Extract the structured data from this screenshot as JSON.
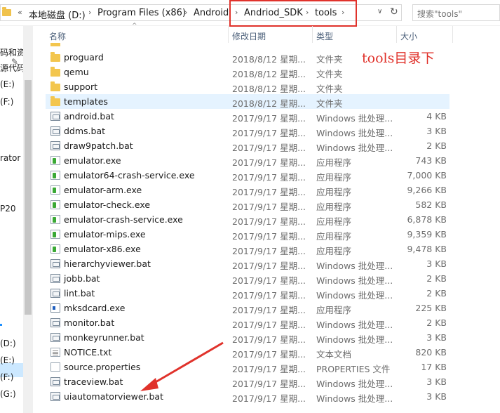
{
  "address": {
    "prefix": "«",
    "crumbs": [
      "本地磁盘 (D:)",
      "Program Files (x86)",
      "Android",
      "Andriod_SDK",
      "tools"
    ],
    "search_placeholder": "搜索\"tools\""
  },
  "nav": {
    "items": [
      "码和资",
      "源代码",
      "(E:)",
      "(F:)",
      "rator",
      "P20",
      "(D:)",
      "(E:)",
      "(F:)",
      "(G:)"
    ]
  },
  "columns": {
    "name": "名称",
    "date": "修改日期",
    "type": "类型",
    "size": "大小"
  },
  "annotation": "tools目录下",
  "accent": "#e0322b",
  "files": [
    {
      "name": "proguard",
      "date": "2018/8/12 星期...",
      "type": "文件夹",
      "size": "",
      "icon": "folder-icon"
    },
    {
      "name": "qemu",
      "date": "2018/8/12 星期...",
      "type": "文件夹",
      "size": "",
      "icon": "folder-icon"
    },
    {
      "name": "support",
      "date": "2018/8/12 星期...",
      "type": "文件夹",
      "size": "",
      "icon": "folder-icon"
    },
    {
      "name": "templates",
      "date": "2018/8/12 星期...",
      "type": "文件夹",
      "size": "",
      "icon": "folder-icon",
      "selected": true
    },
    {
      "name": "android.bat",
      "date": "2017/9/17 星期...",
      "type": "Windows 批处理...",
      "size": "4 KB",
      "icon": "batch-file-icon"
    },
    {
      "name": "ddms.bat",
      "date": "2017/9/17 星期...",
      "type": "Windows 批处理...",
      "size": "3 KB",
      "icon": "batch-file-icon"
    },
    {
      "name": "draw9patch.bat",
      "date": "2017/9/17 星期...",
      "type": "Windows 批处理...",
      "size": "2 KB",
      "icon": "batch-file-icon"
    },
    {
      "name": "emulator.exe",
      "date": "2017/9/17 星期...",
      "type": "应用程序",
      "size": "743 KB",
      "icon": "exe-icon"
    },
    {
      "name": "emulator64-crash-service.exe",
      "date": "2017/9/17 星期...",
      "type": "应用程序",
      "size": "7,000 KB",
      "icon": "exe-icon"
    },
    {
      "name": "emulator-arm.exe",
      "date": "2017/9/17 星期...",
      "type": "应用程序",
      "size": "9,266 KB",
      "icon": "exe-icon"
    },
    {
      "name": "emulator-check.exe",
      "date": "2017/9/17 星期...",
      "type": "应用程序",
      "size": "582 KB",
      "icon": "exe-icon"
    },
    {
      "name": "emulator-crash-service.exe",
      "date": "2017/9/17 星期...",
      "type": "应用程序",
      "size": "6,878 KB",
      "icon": "exe-icon"
    },
    {
      "name": "emulator-mips.exe",
      "date": "2017/9/17 星期...",
      "type": "应用程序",
      "size": "9,359 KB",
      "icon": "exe-icon"
    },
    {
      "name": "emulator-x86.exe",
      "date": "2017/9/17 星期...",
      "type": "应用程序",
      "size": "9,478 KB",
      "icon": "exe-icon"
    },
    {
      "name": "hierarchyviewer.bat",
      "date": "2017/9/17 星期...",
      "type": "Windows 批处理...",
      "size": "3 KB",
      "icon": "batch-file-icon"
    },
    {
      "name": "jobb.bat",
      "date": "2017/9/17 星期...",
      "type": "Windows 批处理...",
      "size": "2 KB",
      "icon": "batch-file-icon"
    },
    {
      "name": "lint.bat",
      "date": "2017/9/17 星期...",
      "type": "Windows 批处理...",
      "size": "2 KB",
      "icon": "batch-file-icon"
    },
    {
      "name": "mksdcard.exe",
      "date": "2017/9/17 星期...",
      "type": "应用程序",
      "size": "225 KB",
      "icon": "mksdcard-icon"
    },
    {
      "name": "monitor.bat",
      "date": "2017/9/17 星期...",
      "type": "Windows 批处理...",
      "size": "2 KB",
      "icon": "batch-file-icon"
    },
    {
      "name": "monkeyrunner.bat",
      "date": "2017/9/17 星期...",
      "type": "Windows 批处理...",
      "size": "3 KB",
      "icon": "batch-file-icon"
    },
    {
      "name": "NOTICE.txt",
      "date": "2017/9/17 星期...",
      "type": "文本文档",
      "size": "820 KB",
      "icon": "text-file-icon"
    },
    {
      "name": "source.properties",
      "date": "2017/9/17 星期...",
      "type": "PROPERTIES 文件",
      "size": "17 KB",
      "icon": "file-icon"
    },
    {
      "name": "traceview.bat",
      "date": "2017/9/17 星期...",
      "type": "Windows 批处理...",
      "size": "3 KB",
      "icon": "batch-file-icon"
    },
    {
      "name": "uiautomatorviewer.bat",
      "date": "2017/9/17 星期...",
      "type": "Windows 批处理...",
      "size": "3 KB",
      "icon": "batch-file-icon"
    }
  ]
}
